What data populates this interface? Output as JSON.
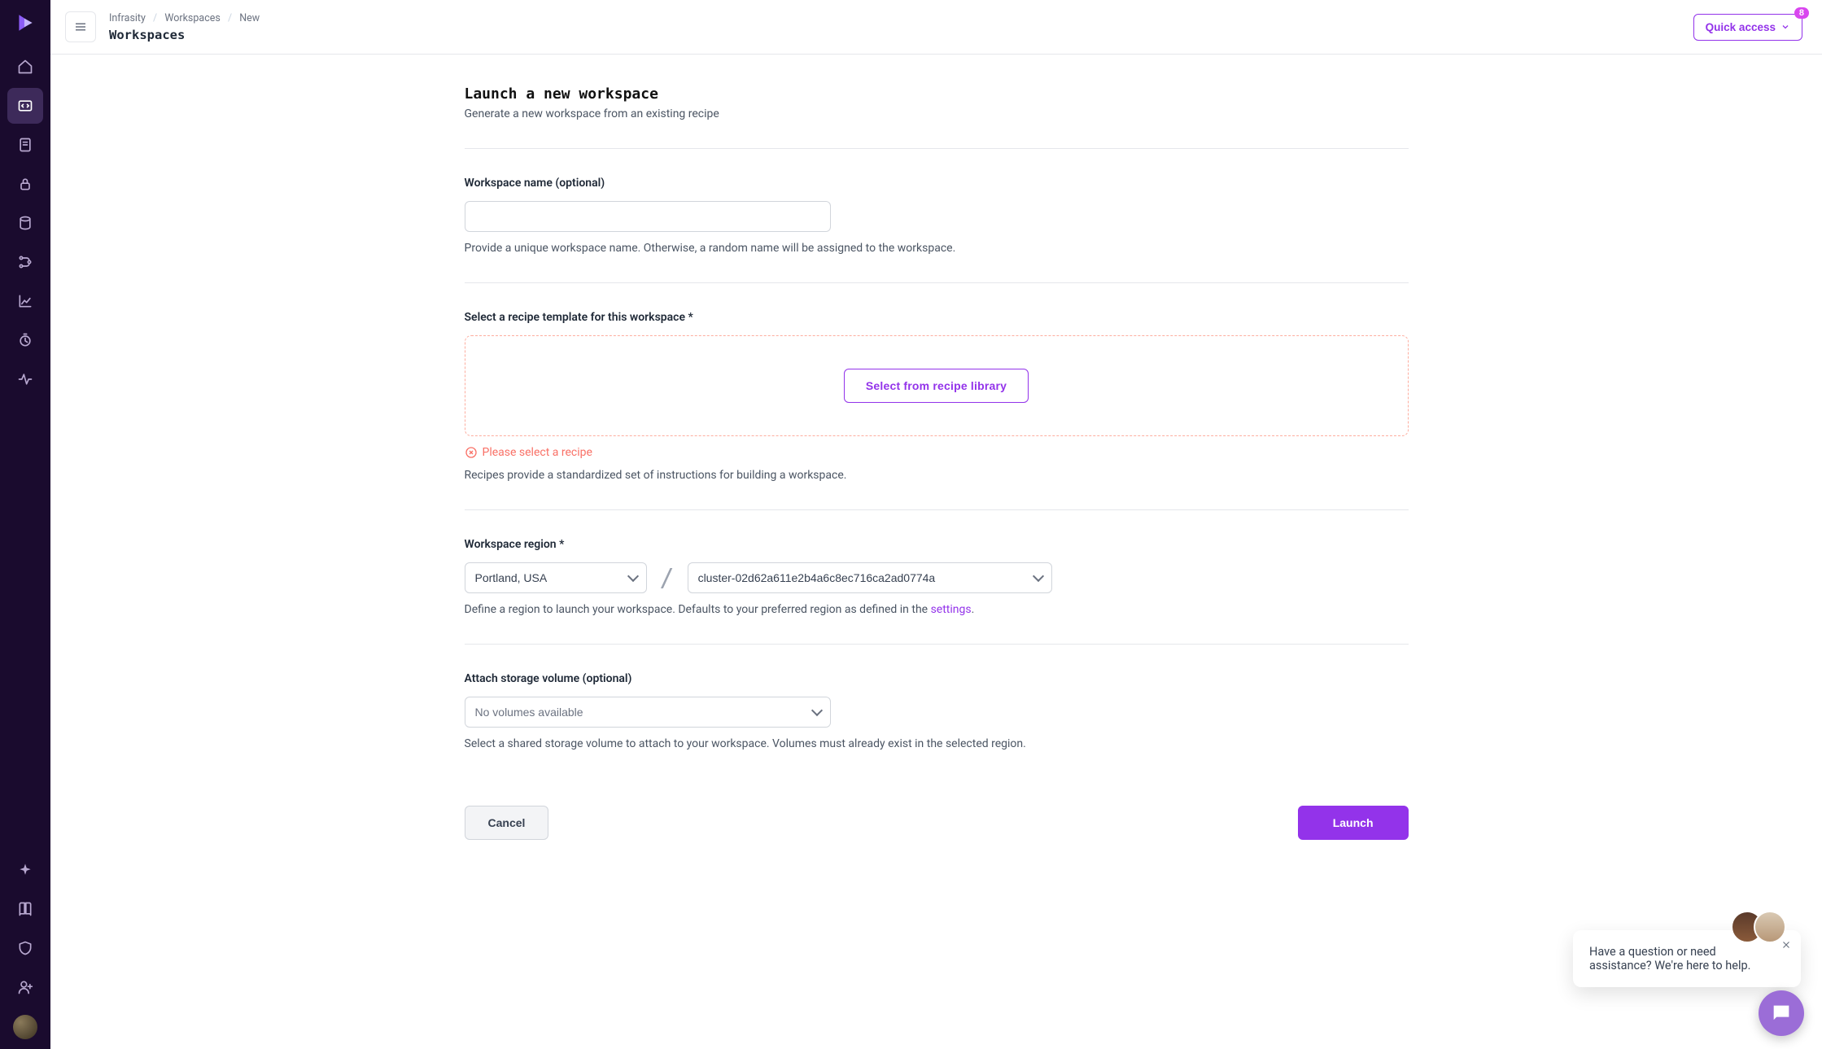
{
  "breadcrumb": {
    "org": "Infrasity",
    "workspaces": "Workspaces",
    "new": "New"
  },
  "page_title": "Workspaces",
  "quick_access": {
    "label": "Quick access",
    "badge": "8"
  },
  "header": {
    "title": "Launch a new workspace",
    "subtitle": "Generate a new workspace from an existing recipe"
  },
  "name_section": {
    "label": "Workspace name (optional)",
    "value": "",
    "help": "Provide a unique workspace name. Otherwise, a random name will be assigned to the workspace."
  },
  "recipe_section": {
    "label": "Select a recipe template for this workspace *",
    "button": "Select from recipe library",
    "error": "Please select a recipe",
    "help": "Recipes provide a standardized set of instructions for building a workspace."
  },
  "region_section": {
    "label": "Workspace region *",
    "region_value": "Portland, USA",
    "cluster_value": "cluster-02d62a611e2b4a6c8ec716ca2ad0774a",
    "help_prefix": "Define a region to launch your workspace. Defaults to your preferred region as defined in the ",
    "help_link": "settings",
    "help_suffix": "."
  },
  "volume_section": {
    "label": "Attach storage volume (optional)",
    "value": "No volumes available",
    "help": "Select a shared storage volume to attach to your workspace. Volumes must already exist in the selected region."
  },
  "actions": {
    "cancel": "Cancel",
    "launch": "Launch"
  },
  "chat": {
    "text": "Have a question or need assistance? We're here to help."
  }
}
